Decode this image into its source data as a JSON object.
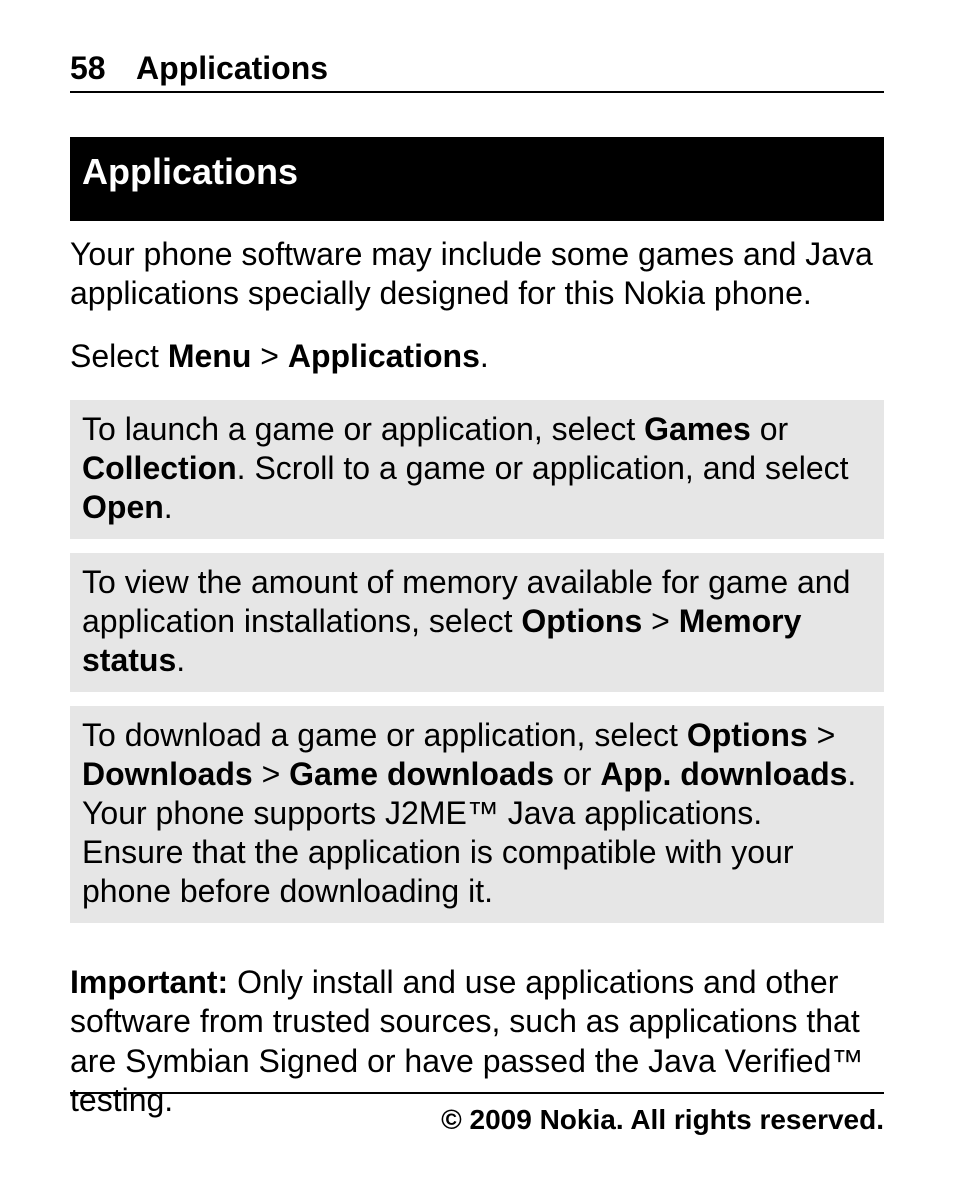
{
  "header": {
    "page_number": "58",
    "section_title": "Applications"
  },
  "banner": {
    "title": "Applications"
  },
  "intro": {
    "p1_a": "Your phone software may include some games and Java applications specially designed for this Nokia phone.",
    "p2_a": "Select ",
    "p2_b": "Menu",
    "p2_c": " > ",
    "p2_d": "Applications",
    "p2_e": "."
  },
  "boxes": [
    {
      "a": "To launch a game or application, select ",
      "b": "Games",
      "c": " or ",
      "d": "Collection",
      "e": ". Scroll to a game or application, and select ",
      "f": "Open",
      "g": "."
    },
    {
      "a": "To view the amount of memory available for game and application installations, select ",
      "b": "Options",
      "c": " > ",
      "d": "Memory status",
      "e": "."
    },
    {
      "a": "To download a game or application, select ",
      "b": "Options",
      "c": " > ",
      "d": "Downloads",
      "e": " > ",
      "f": "Game downloads",
      "g": " or ",
      "h": "App. downloads",
      "i": ". Your phone supports J2ME™ Java applications. Ensure that the application is compatible with your phone before downloading it."
    }
  ],
  "important": {
    "label": "Important:",
    "text": "  Only install and use applications and other software from trusted sources, such as applications that are Symbian Signed or have passed the Java Verified™ testing."
  },
  "footer": {
    "copyright": "© 2009 Nokia. All rights reserved."
  }
}
